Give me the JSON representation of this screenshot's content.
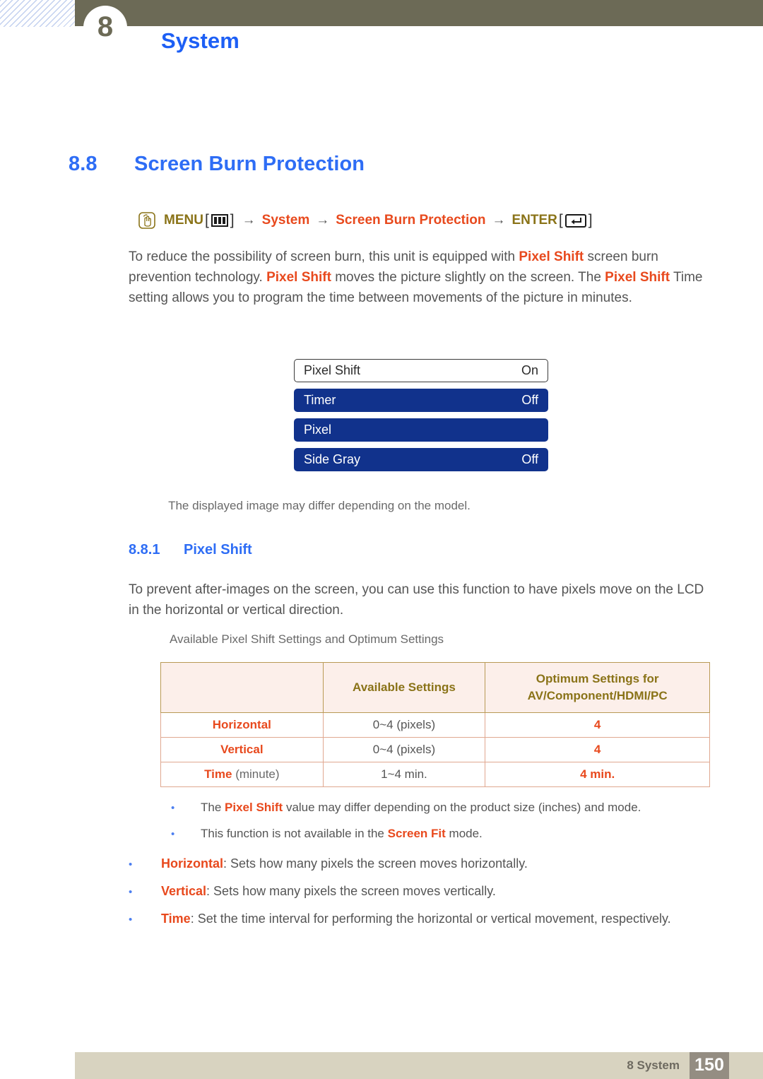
{
  "header": {
    "chapter_number": "8",
    "chapter_title": "System"
  },
  "section": {
    "number": "8.8",
    "title": "Screen Burn Protection"
  },
  "nav_path": {
    "hand_icon": "hand-press-icon",
    "menu_label": "MENU",
    "menu_icon": "menu-bars-icon",
    "arrow1": "→",
    "step1": "System",
    "arrow2": "→",
    "step2": "Screen Burn Protection",
    "arrow3": "→",
    "enter_label": "ENTER",
    "enter_icon": "enter-key-icon",
    "bracket_open": "[",
    "bracket_close": "]"
  },
  "intro_paragraph": {
    "p1": "To reduce the possibility of screen burn, this unit is equipped with ",
    "b1": "Pixel Shift",
    "p2": " screen burn prevention technology. ",
    "b2": "Pixel Shift",
    "p3": " moves the picture slightly on the screen. The ",
    "b3": "Pixel Shift",
    "p4": " Time setting allows you to program the time between movements of the picture in minutes."
  },
  "osd_menu": {
    "rows": [
      {
        "label": "Pixel Shift",
        "value": "On",
        "selected": true
      },
      {
        "label": "Timer",
        "value": "Off",
        "selected": false
      },
      {
        "label": "Pixel",
        "value": "",
        "selected": false
      },
      {
        "label": "Side Gray",
        "value": "Off",
        "selected": false
      }
    ],
    "caption": "The displayed image may differ depending on the model."
  },
  "subsection": {
    "number": "8.8.1",
    "title": "Pixel Shift",
    "paragraph": "To prevent after-images on the screen, you can use this function to have pixels move on the LCD in the horizontal or vertical direction.",
    "table_intro": "Available Pixel Shift Settings and Optimum Settings"
  },
  "settings_table": {
    "headers": [
      "",
      "Available Settings",
      "Optimum Settings for\nAV/Component/HDMI/PC"
    ],
    "header_line1": "Optimum Settings for",
    "header_line2": "AV/Component/HDMI/PC",
    "header_col2": "Available Settings",
    "rows": [
      {
        "label": "Horizontal",
        "unit": "",
        "available": "0~4 (pixels)",
        "optimum": "4"
      },
      {
        "label": "Vertical",
        "unit": "",
        "available": "0~4 (pixels)",
        "optimum": "4"
      },
      {
        "label": "Time",
        "unit": " (minute)",
        "available": "1~4 min.",
        "optimum": "4 min."
      }
    ]
  },
  "notes": [
    {
      "pre": "The ",
      "bold": "Pixel Shift",
      "post": " value may differ depending on the product size (inches) and mode."
    },
    {
      "pre": "This function is not available in the ",
      "bold": "Screen Fit",
      "post": " mode."
    }
  ],
  "options": [
    {
      "bold": "Horizontal",
      "post": ": Sets how many pixels the screen moves horizontally."
    },
    {
      "bold": "Vertical",
      "post": ": Sets how many pixels the screen moves vertically."
    },
    {
      "bold": "Time",
      "post": ": Set the time interval for performing the horizontal or vertical movement, respectively."
    }
  ],
  "footer": {
    "label": "8 System",
    "page_number": "150"
  },
  "colors": {
    "heading_blue": "#2e6df5",
    "accent_red": "#e8491d",
    "olive": "#8a7318",
    "header_bar": "#6c6a56",
    "osd_blue": "#11328c",
    "footer_beige": "#d8d3c0",
    "page_box": "#948d82"
  },
  "bullet_glyph": "•"
}
